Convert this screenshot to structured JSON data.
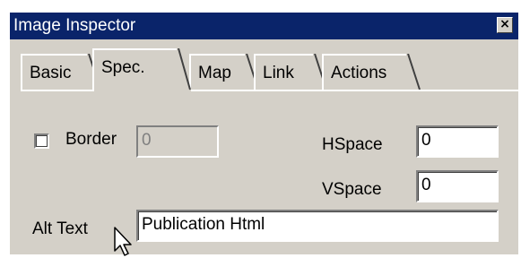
{
  "window": {
    "title": "Image Inspector",
    "close_glyph": "×"
  },
  "tabs": [
    {
      "label": "Basic",
      "active": false
    },
    {
      "label": "Spec.",
      "active": true
    },
    {
      "label": "Map",
      "active": false
    },
    {
      "label": "Link",
      "active": false
    },
    {
      "label": "Actions",
      "active": false
    }
  ],
  "spec": {
    "border_label": "Border",
    "border_checked": false,
    "border_value": "0",
    "hspace_label": "HSpace",
    "hspace_value": "0",
    "vspace_label": "VSpace",
    "vspace_value": "0",
    "alt_label": "Alt Text",
    "alt_value": "Publication Html"
  },
  "colors": {
    "titlebar": "#0a246a",
    "face": "#d4d0c8"
  },
  "icons": {
    "close": "close-icon",
    "cursor": "mouse-pointer-icon"
  }
}
